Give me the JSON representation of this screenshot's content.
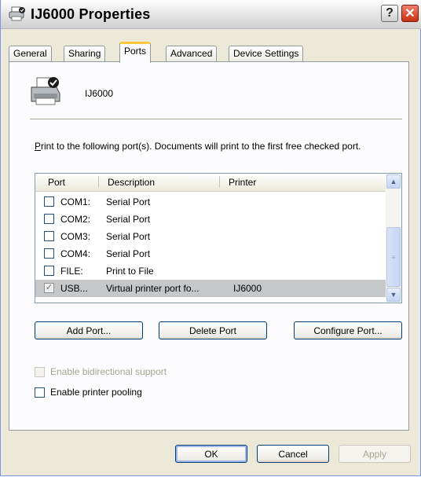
{
  "window": {
    "title": "IJ6000 Properties",
    "help_label": "?",
    "close_label": "✕"
  },
  "tabs": [
    {
      "label": "General",
      "active": false
    },
    {
      "label": "Sharing",
      "active": false
    },
    {
      "label": "Ports",
      "active": true
    },
    {
      "label": "Advanced",
      "active": false
    },
    {
      "label": "Device Settings",
      "active": false
    }
  ],
  "printer": {
    "name": "IJ6000"
  },
  "description": {
    "prefix_key": "P",
    "text": "rint to the following port(s). Documents will print to the first free checked port."
  },
  "port_list": {
    "columns": [
      "Port",
      "Description",
      "Printer"
    ],
    "rows": [
      {
        "port": "COM1:",
        "description": "Serial Port",
        "printer": "",
        "checked": false,
        "selected": false
      },
      {
        "port": "COM2:",
        "description": "Serial Port",
        "printer": "",
        "checked": false,
        "selected": false
      },
      {
        "port": "COM3:",
        "description": "Serial Port",
        "printer": "",
        "checked": false,
        "selected": false
      },
      {
        "port": "COM4:",
        "description": "Serial Port",
        "printer": "",
        "checked": false,
        "selected": false
      },
      {
        "port": "FILE:",
        "description": "Print to File",
        "printer": "",
        "checked": false,
        "selected": false
      },
      {
        "port": "USB...",
        "description": "Virtual printer port fo...",
        "printer": "IJ6000",
        "checked": true,
        "selected": true
      }
    ]
  },
  "buttons": {
    "add_port": "Add Port...",
    "delete_port": "Delete Port",
    "configure_port": "Configure Port..."
  },
  "options": {
    "bidirectional": {
      "label": "Enable bidirectional support",
      "checked": false,
      "enabled": false
    },
    "pooling": {
      "label": "Enable printer pooling",
      "checked": false,
      "enabled": true
    }
  },
  "footer": {
    "ok": "OK",
    "cancel": "Cancel",
    "apply": "Apply"
  }
}
